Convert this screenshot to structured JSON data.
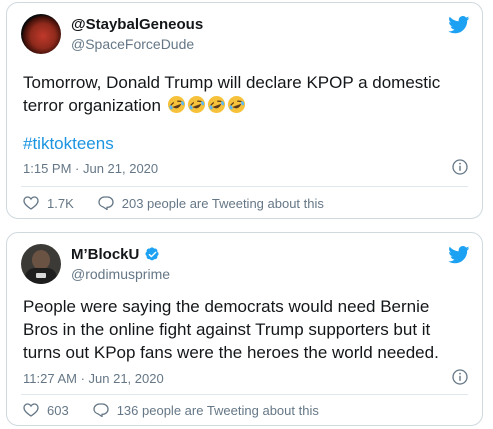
{
  "tweets": [
    {
      "display_name": "@StaybalGeneous",
      "handle": "@SpaceForceDude",
      "verified": false,
      "text": "Tomorrow, Donald Trump will declare KPOP a domestic terror organization",
      "emojis": [
        "rolling-on-floor-laughing",
        "rolling-on-floor-laughing",
        "rolling-on-floor-laughing",
        "rolling-on-floor-laughing"
      ],
      "hashtag": "#tiktokteens",
      "timestamp": "1:15 PM · Jun 21, 2020",
      "likes": "1.7K",
      "tweeting_about": "203 people are Tweeting about this"
    },
    {
      "display_name": "M’BlockU",
      "handle": "@rodimusprime",
      "verified": true,
      "text": "People were saying the democrats would need Bernie Bros in the online fight against Trump supporters but it turns out KPop fans were the heroes the world needed.",
      "timestamp": "11:27 AM · Jun 21, 2020",
      "likes": "603",
      "tweeting_about": "136 people are Tweeting about this"
    }
  ],
  "colors": {
    "twitter_blue": "#1da1f2",
    "hashtag_blue": "#1b95e0",
    "text": "#14171a",
    "secondary_text": "#657786",
    "border": "#cfd9de"
  },
  "icons": [
    "twitter-bird-icon",
    "verified-badge-icon",
    "info-icon",
    "heart-icon",
    "reply-bubble-icon",
    "rolling-laughing-emoji"
  ]
}
